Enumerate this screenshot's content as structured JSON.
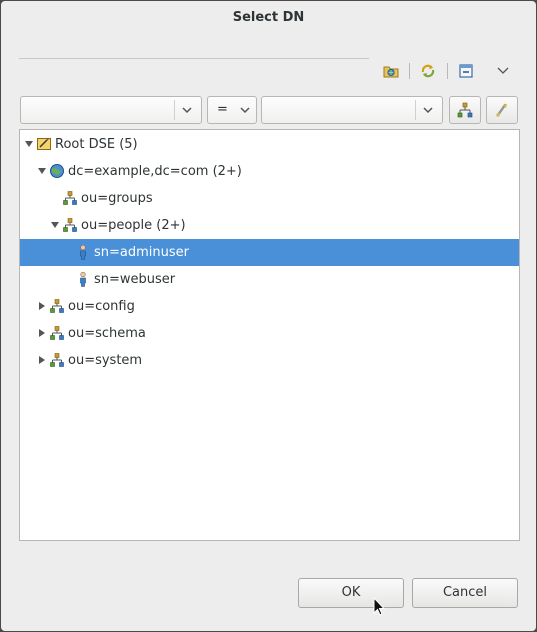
{
  "dialog": {
    "title": "Select DN"
  },
  "toolbar": {
    "icons": [
      "home-folder-icon",
      "refresh-icon",
      "collapse-all-icon",
      "view-menu-icon"
    ]
  },
  "filter": {
    "attribute_value": "",
    "operator_value": "=",
    "value_value": ""
  },
  "tree": {
    "items": [
      {
        "label": "Root DSE (5)",
        "icon": "root-dse-icon",
        "state": "expanded",
        "selected": false
      },
      {
        "label": "dc=example,dc=com (2+)",
        "icon": "globe-icon",
        "state": "expanded",
        "selected": false
      },
      {
        "label": "ou=groups",
        "icon": "org-unit-icon",
        "state": "leaf",
        "selected": false
      },
      {
        "label": "ou=people (2+)",
        "icon": "org-unit-icon",
        "state": "expanded",
        "selected": false
      },
      {
        "label": "sn=adminuser",
        "icon": "person-icon",
        "state": "leaf",
        "selected": true
      },
      {
        "label": "sn=webuser",
        "icon": "person-icon",
        "state": "leaf",
        "selected": false
      },
      {
        "label": "ou=config",
        "icon": "org-unit-icon",
        "state": "collapsed",
        "selected": false
      },
      {
        "label": "ou=schema",
        "icon": "org-unit-icon",
        "state": "collapsed",
        "selected": false
      },
      {
        "label": "ou=system",
        "icon": "org-unit-icon",
        "state": "collapsed",
        "selected": false
      }
    ]
  },
  "buttons": {
    "ok_label": "OK",
    "cancel_label": "Cancel"
  },
  "colors": {
    "selection": "#4a90d9",
    "dialog_bg": "#ededed",
    "tree_bg": "#ffffff"
  }
}
